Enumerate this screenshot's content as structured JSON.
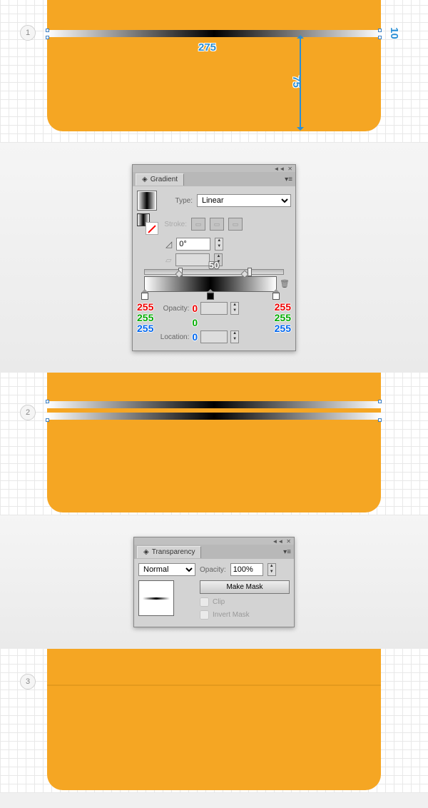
{
  "steps": {
    "s1": "1",
    "s2": "2",
    "s3": "3"
  },
  "dims": {
    "w": "275",
    "h": "10",
    "depth": "75"
  },
  "gradient_panel": {
    "title": "Gradient",
    "type_label": "Type:",
    "type_value": "Linear",
    "stroke_label": "Stroke:",
    "angle_label": "0°",
    "aspect_value": "",
    "mid_label": "50",
    "opacity_label": "Opacity:",
    "location_label": "Location:",
    "stops": {
      "left": {
        "r": "255",
        "g": "255",
        "b": "255"
      },
      "mid": {
        "r": "0",
        "g": "0",
        "b": "0"
      },
      "right": {
        "r": "255",
        "g": "255",
        "b": "255"
      }
    }
  },
  "transparency_panel": {
    "title": "Transparency",
    "mode": "Normal",
    "opacity_label": "Opacity:",
    "opacity_value": "100%",
    "make_mask": "Make Mask",
    "clip": "Clip",
    "invert": "Invert Mask"
  },
  "chart_data": null
}
